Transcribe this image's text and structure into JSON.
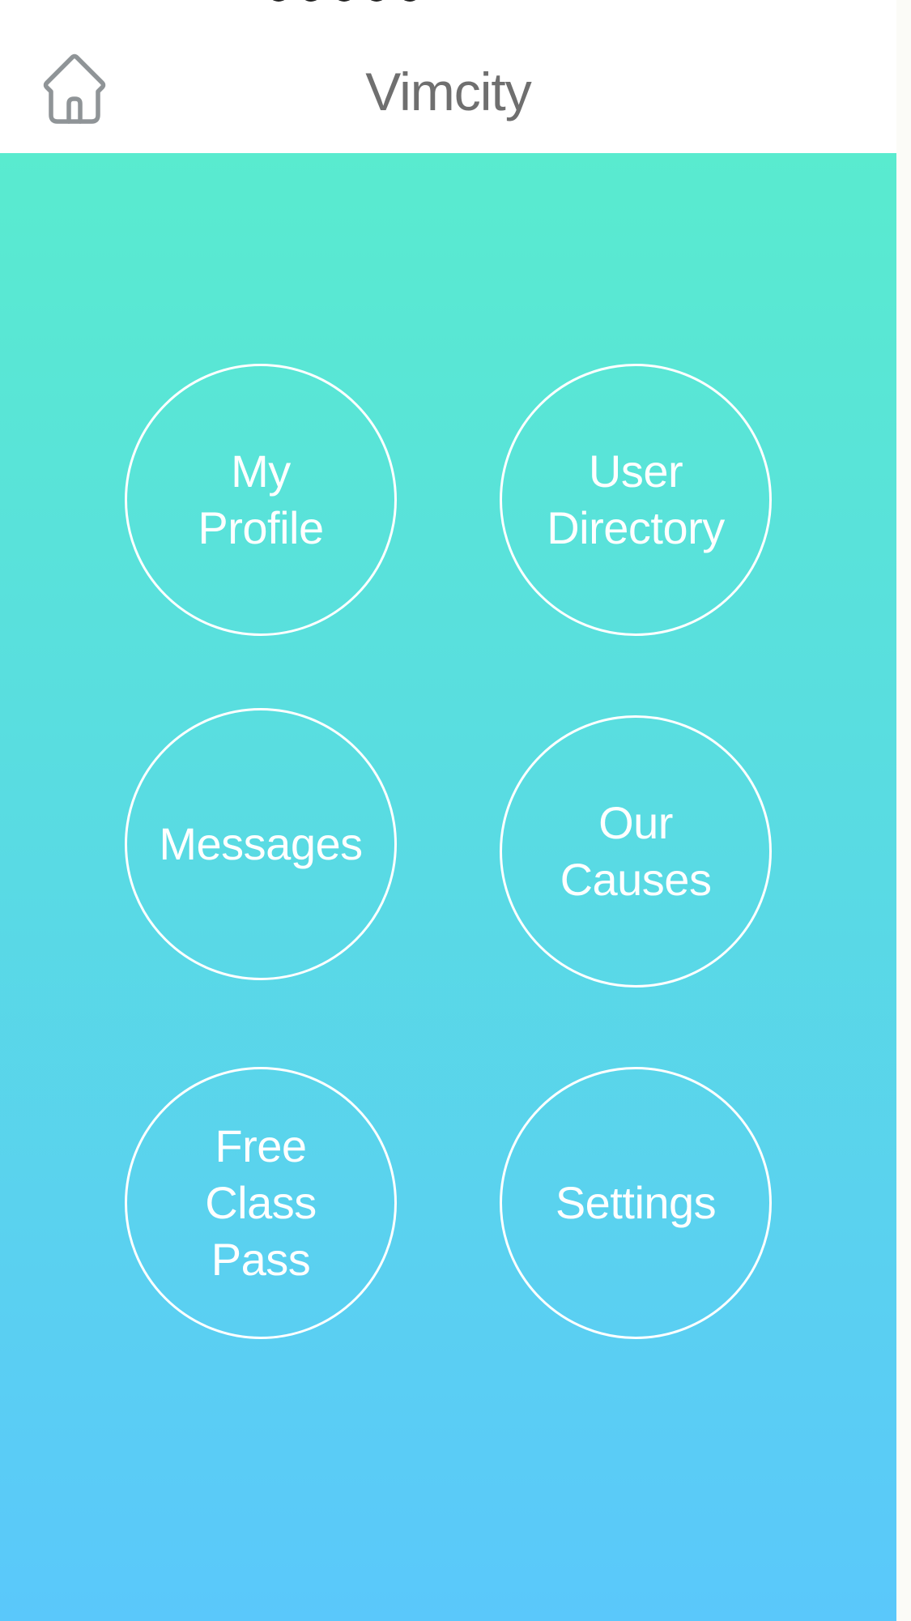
{
  "header": {
    "title": "Vimcity",
    "home_icon": "home-icon"
  },
  "menu": {
    "my_profile": {
      "line1": "My",
      "line2": "Profile"
    },
    "user_directory": {
      "line1": "User",
      "line2": "Directory"
    },
    "messages": {
      "line1": "Messages"
    },
    "our_causes": {
      "line1": "Our",
      "line2": "Causes"
    },
    "free_class_pass": {
      "line1": "Free",
      "line2": "Class",
      "line3": "Pass"
    },
    "settings": {
      "line1": "Settings"
    }
  },
  "colors": {
    "gradient_top": "#59ebcf",
    "gradient_bottom": "#5ac8fb",
    "title_text": "#6f6f6f",
    "tile_outline": "#ffffff"
  }
}
